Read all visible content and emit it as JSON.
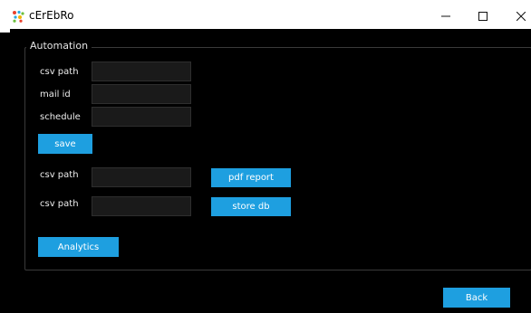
{
  "window": {
    "title": "cErEbRo",
    "app_icon": "app-logo-icon",
    "controls": [
      "minimize-icon",
      "maximize-icon",
      "close-icon"
    ]
  },
  "automation": {
    "group_title": "Automation",
    "csv_path_label": "csv path",
    "mail_id_label": "mail id",
    "schedule_label": "schedule",
    "csv_path_value": "",
    "mail_id_value": "",
    "schedule_value": "",
    "save_label": "save"
  },
  "report": {
    "csv_path_label": "csv path",
    "csv_path_value": "",
    "pdf_report_label": "pdf report"
  },
  "store": {
    "csv_path_label": "csv path",
    "csv_path_value": "",
    "store_db_label": "store db"
  },
  "analytics_label": "Analytics",
  "back_label": "Back",
  "colors": {
    "accent": "#1e9fe0",
    "background": "#000000",
    "field": "#1a1a1a",
    "text": "#ededed"
  }
}
